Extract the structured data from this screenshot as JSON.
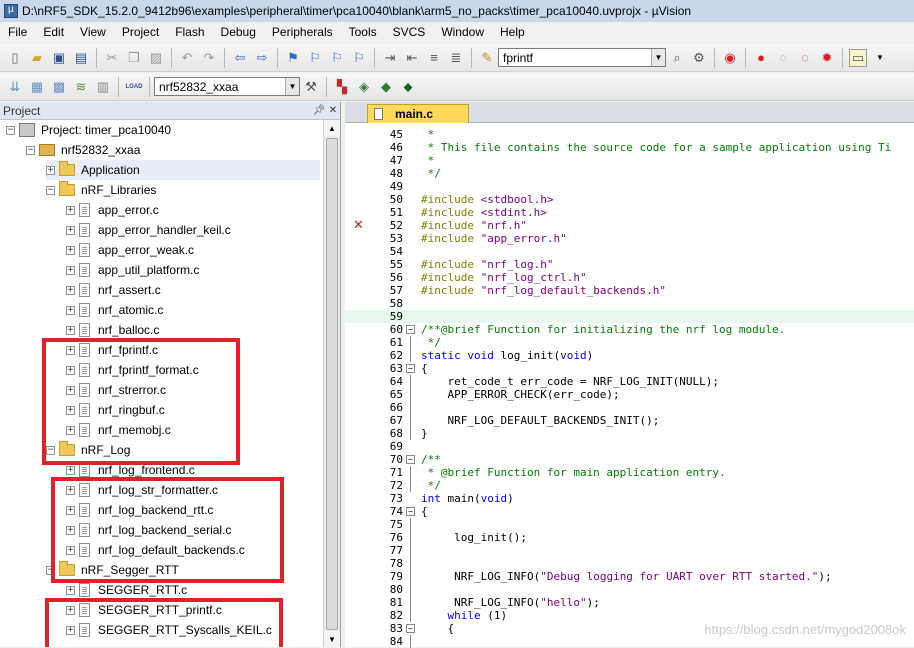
{
  "window": {
    "title": "D:\\nRF5_SDK_15.2.0_9412b96\\examples\\peripheral\\timer\\pca10040\\blank\\arm5_no_packs\\timer_pca10040.uvprojx - µVision"
  },
  "menu": [
    "File",
    "Edit",
    "View",
    "Project",
    "Flash",
    "Debug",
    "Peripherals",
    "Tools",
    "SVCS",
    "Window",
    "Help"
  ],
  "toolbar": {
    "find_value": "fprintf",
    "target_value": "nrf52832_xxaa",
    "load_label": "LOAD"
  },
  "project_panel": {
    "title": "Project",
    "items": [
      {
        "label": "Project: timer_pca10040",
        "expander": "−"
      },
      {
        "label": "nrf52832_xxaa",
        "expander": "−"
      },
      {
        "label": "Application",
        "expander": "+"
      },
      {
        "label": "nRF_Libraries",
        "expander": "−"
      },
      {
        "label": "app_error.c",
        "expander": "+"
      },
      {
        "label": "app_error_handler_keil.c",
        "expander": "+"
      },
      {
        "label": "app_error_weak.c",
        "expander": "+"
      },
      {
        "label": "app_util_platform.c",
        "expander": "+"
      },
      {
        "label": "nrf_assert.c",
        "expander": "+"
      },
      {
        "label": "nrf_atomic.c",
        "expander": "+"
      },
      {
        "label": "nrf_balloc.c",
        "expander": "+"
      },
      {
        "label": "nrf_fprintf.c",
        "expander": "+"
      },
      {
        "label": "nrf_fprintf_format.c",
        "expander": "+"
      },
      {
        "label": "nrf_strerror.c",
        "expander": "+"
      },
      {
        "label": "nrf_ringbuf.c",
        "expander": "+"
      },
      {
        "label": "nrf_memobj.c",
        "expander": "+"
      },
      {
        "label": "nRF_Log",
        "expander": "−"
      },
      {
        "label": "nrf_log_frontend.c",
        "expander": "+"
      },
      {
        "label": "nrf_log_str_formatter.c",
        "expander": "+"
      },
      {
        "label": "nrf_log_backend_rtt.c",
        "expander": "+"
      },
      {
        "label": "nrf_log_backend_serial.c",
        "expander": "+"
      },
      {
        "label": "nrf_log_default_backends.c",
        "expander": "+"
      },
      {
        "label": "nRF_Segger_RTT",
        "expander": "−"
      },
      {
        "label": "SEGGER_RTT.c",
        "expander": "+"
      },
      {
        "label": "SEGGER_RTT_printf.c",
        "expander": "+"
      },
      {
        "label": "SEGGER_RTT_Syscalls_KEIL.c",
        "expander": "+"
      }
    ]
  },
  "editor": {
    "tab_label": "main.c",
    "lines": [
      {
        "n": "45",
        "t": " *"
      },
      {
        "n": "46",
        "t": " * This file contains the source code for a sample application using Ti"
      },
      {
        "n": "47",
        "t": " *"
      },
      {
        "n": "48",
        "t": " */"
      },
      {
        "n": "49",
        "t": ""
      },
      {
        "n": "50",
        "t": "#include <stdbool.h>"
      },
      {
        "n": "51",
        "t": "#include <stdint.h>"
      },
      {
        "n": "52",
        "t": "#include \"nrf.h\""
      },
      {
        "n": "53",
        "t": "#include \"app_error.h\""
      },
      {
        "n": "54",
        "t": ""
      },
      {
        "n": "55",
        "t": "#include \"nrf_log.h\""
      },
      {
        "n": "56",
        "t": "#include \"nrf_log_ctrl.h\""
      },
      {
        "n": "57",
        "t": "#include \"nrf_log_default_backends.h\""
      },
      {
        "n": "58",
        "t": ""
      },
      {
        "n": "59",
        "t": ""
      },
      {
        "n": "60",
        "t": "/**@brief Function for initializing the nrf log module."
      },
      {
        "n": "61",
        "t": " */"
      },
      {
        "n": "62",
        "t": "static void log_init(void)"
      },
      {
        "n": "63",
        "t": "{"
      },
      {
        "n": "64",
        "t": "    ret_code_t err_code = NRF_LOG_INIT(NULL);"
      },
      {
        "n": "65",
        "t": "    APP_ERROR_CHECK(err_code);"
      },
      {
        "n": "66",
        "t": ""
      },
      {
        "n": "67",
        "t": "    NRF_LOG_DEFAULT_BACKENDS_INIT();"
      },
      {
        "n": "68",
        "t": "}"
      },
      {
        "n": "69",
        "t": ""
      },
      {
        "n": "70",
        "t": "/**"
      },
      {
        "n": "71",
        "t": " * @brief Function for main application entry."
      },
      {
        "n": "72",
        "t": " */"
      },
      {
        "n": "73",
        "t": "int main(void)"
      },
      {
        "n": "74",
        "t": "{"
      },
      {
        "n": "75",
        "t": ""
      },
      {
        "n": "76",
        "t": "     log_init();"
      },
      {
        "n": "77",
        "t": ""
      },
      {
        "n": "78",
        "t": ""
      },
      {
        "n": "79",
        "t": "     NRF_LOG_INFO(\"Debug logging for UART over RTT started.\");"
      },
      {
        "n": "80",
        "t": ""
      },
      {
        "n": "81",
        "t": "     NRF_LOG_INFO(\"hello\");"
      },
      {
        "n": "82",
        "t": "    while (1)"
      },
      {
        "n": "83",
        "t": "    {"
      },
      {
        "n": "84",
        "t": ""
      }
    ]
  },
  "watermark": "https://blog.csdn.net/mygod2008ok",
  "colors": {
    "highlight_box": "#e0212a",
    "tab_active": "#ffd95a",
    "error_mark": "#d81e1e"
  }
}
